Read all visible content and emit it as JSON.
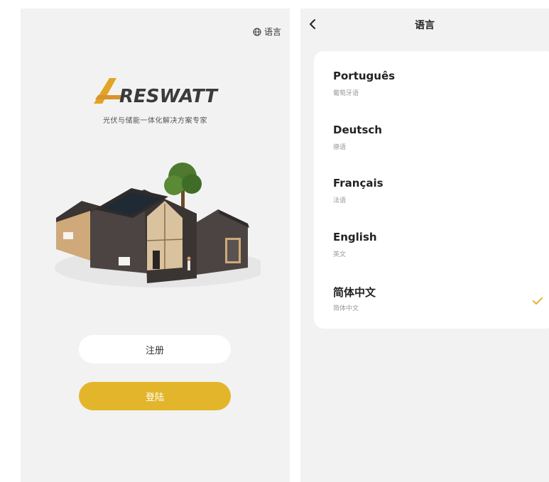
{
  "left_screen": {
    "language_button": "语言",
    "logo_text": "RESWATT",
    "slogan": "光伏与储能一体化解决方案专家",
    "register_label": "注册",
    "login_label": "登陆"
  },
  "right_screen": {
    "title": "语言",
    "languages": [
      {
        "name": "Português",
        "native": "葡萄牙语",
        "selected": false
      },
      {
        "name": "Deutsch",
        "native": "德语",
        "selected": false
      },
      {
        "name": "Français",
        "native": "法语",
        "selected": false
      },
      {
        "name": "English",
        "native": "英文",
        "selected": false
      },
      {
        "name": "简体中文",
        "native": "简体中文",
        "selected": true
      }
    ]
  },
  "colors": {
    "accent": "#e3b52a",
    "background": "#f2f2f2",
    "check": "#e3b52a"
  }
}
